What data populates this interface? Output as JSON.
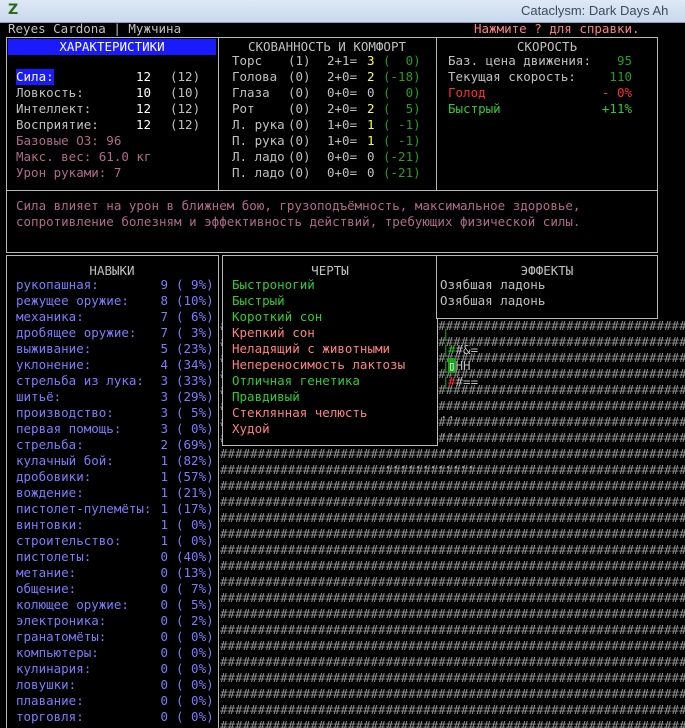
{
  "window": {
    "title": "Cataclysm: Dark Days Ah",
    "app_icon": "Z"
  },
  "header": {
    "name_gender": "Reyes Cardona | Мужчина",
    "help_hint": "Нажмите ? для справки."
  },
  "stats": {
    "title": "ХАРАКТЕРИСТИКИ",
    "rows": [
      {
        "label": "Сила:",
        "value": "12",
        "base": "(12)"
      },
      {
        "label": "Ловкость:",
        "value": "10",
        "base": "(10)"
      },
      {
        "label": "Интеллект:",
        "value": "12",
        "base": "(12)"
      },
      {
        "label": "Восприятие:",
        "value": "12",
        "base": "(12)"
      }
    ],
    "derived": [
      "Базовые ОЗ: 96",
      "Макс. вес: 61.0 кг",
      "Урон руками: 7"
    ]
  },
  "encumbrance": {
    "title": "СКОВАННОСТЬ И КОМФОРТ",
    "rows": [
      {
        "part": "Торс",
        "layers": "(1)",
        "calc": "2+1=",
        "total": "3",
        "warmth": "(  0)"
      },
      {
        "part": "Голова",
        "layers": "(0)",
        "calc": "2+0=",
        "total": "2",
        "warmth": "(-18)"
      },
      {
        "part": "Глаза",
        "layers": "(0)",
        "calc": "0+0=",
        "total": "0",
        "warmth": "(  0)"
      },
      {
        "part": "Рот",
        "layers": "(0)",
        "calc": "2+0=",
        "total": "2",
        "warmth": "(  5)"
      },
      {
        "part": "Л. рука",
        "layers": "(0)",
        "calc": "1+0=",
        "total": "1",
        "warmth": "( -1)"
      },
      {
        "part": "П. рука",
        "layers": "(0)",
        "calc": "1+0=",
        "total": "1",
        "warmth": "( -1)"
      },
      {
        "part": "Л. ладо",
        "layers": "(0)",
        "calc": "0+0=",
        "total": "0",
        "warmth": "(-21)"
      },
      {
        "part": "П. ладо",
        "layers": "(0)",
        "calc": "0+0=",
        "total": "0",
        "warmth": "(-21)"
      }
    ]
  },
  "speed": {
    "title": "СКОРОСТЬ",
    "rows": [
      {
        "label": "Баз. цена движения:",
        "value": "95"
      },
      {
        "label": "Текущая скорость:",
        "value": "110"
      },
      {
        "label": "Голод",
        "value": "- 0%"
      },
      {
        "label": "Быстрый",
        "value": "+11%"
      }
    ]
  },
  "description": {
    "line1": "Сила влияет на урон в ближнем бою, грузоподъёмность, максимальное здоровье,",
    "line2": "сопротивление болезням и эффективность действий, требующих физической силы."
  },
  "skills": {
    "title": "НАВЫКИ",
    "rows": [
      {
        "name": "рукопашная:",
        "level": "9",
        "pct": "( 9%)"
      },
      {
        "name": "режущее оружие:",
        "level": "8",
        "pct": "(10%)"
      },
      {
        "name": "механика:",
        "level": "7",
        "pct": "( 6%)"
      },
      {
        "name": "дробящее оружие:",
        "level": "7",
        "pct": "( 3%)"
      },
      {
        "name": "выживание:",
        "level": "5",
        "pct": "(23%)"
      },
      {
        "name": "уклонение:",
        "level": "4",
        "pct": "(34%)"
      },
      {
        "name": "стрельба из лука:",
        "level": "3",
        "pct": "(33%)"
      },
      {
        "name": "шитьё:",
        "level": "3",
        "pct": "(29%)"
      },
      {
        "name": "производство:",
        "level": "3",
        "pct": "( 5%)"
      },
      {
        "name": "первая помощь:",
        "level": "3",
        "pct": "( 0%)"
      },
      {
        "name": "стрельба:",
        "level": "2",
        "pct": "(69%)"
      },
      {
        "name": "кулачный бой:",
        "level": "1",
        "pct": "(82%)"
      },
      {
        "name": "дробовики:",
        "level": "1",
        "pct": "(57%)"
      },
      {
        "name": "вождение:",
        "level": "1",
        "pct": "(21%)"
      },
      {
        "name": "пистолет-пулемёты:",
        "level": "1",
        "pct": "(17%)"
      },
      {
        "name": "винтовки:",
        "level": "1",
        "pct": "( 0%)"
      },
      {
        "name": "строительство:",
        "level": "1",
        "pct": "( 0%)"
      },
      {
        "name": "пистолеты:",
        "level": "0",
        "pct": "(40%)"
      },
      {
        "name": "метание:",
        "level": "0",
        "pct": "(13%)"
      },
      {
        "name": "общение:",
        "level": "0",
        "pct": "( 7%)"
      },
      {
        "name": "колющее оружие:",
        "level": "0",
        "pct": "( 5%)"
      },
      {
        "name": "электроника:",
        "level": "0",
        "pct": "( 2%)"
      },
      {
        "name": "гранатомёты:",
        "level": "0",
        "pct": "( 0%)"
      },
      {
        "name": "компьютеры:",
        "level": "0",
        "pct": "( 0%)"
      },
      {
        "name": "кулинария:",
        "level": "0",
        "pct": "( 0%)"
      },
      {
        "name": "ловушки:",
        "level": "0",
        "pct": "( 0%)"
      },
      {
        "name": "плавание:",
        "level": "0",
        "pct": "( 0%)"
      },
      {
        "name": "торговля:",
        "level": "0",
        "pct": "( 0%)"
      }
    ]
  },
  "traits": {
    "title": "ЧЕРТЫ",
    "items": [
      {
        "name": "Быстроногий",
        "kind": "good"
      },
      {
        "name": "Быстрый",
        "kind": "good"
      },
      {
        "name": "Короткий сон",
        "kind": "good"
      },
      {
        "name": "Крепкий сон",
        "kind": "bad"
      },
      {
        "name": "Неладящий с животными",
        "kind": "bad"
      },
      {
        "name": "Непереносимость лактозы",
        "kind": "bad"
      },
      {
        "name": "Отличная генетика",
        "kind": "good"
      },
      {
        "name": "Правдивый",
        "kind": "good"
      },
      {
        "name": "Стеклянная челюсть",
        "kind": "bad"
      },
      {
        "name": "Худой",
        "kind": "bad"
      }
    ]
  },
  "effects": {
    "title": "ЭФФЕКТЫ",
    "items": [
      "Озябшая ладонь",
      "Озябшая ладонь"
    ]
  },
  "map": {
    "fragments": [
      "#&=",
      "HH",
      "#==",
      "..",
      "...",
      "...",
      "............"
    ]
  },
  "colors": {
    "selected_bg": "#1a1aff",
    "good_trait": "#2ecc2e",
    "bad_trait": "#ff8080",
    "skill_text": "#7c7cff",
    "description_text": "#b06a8a",
    "border": "#b8b8b8"
  }
}
